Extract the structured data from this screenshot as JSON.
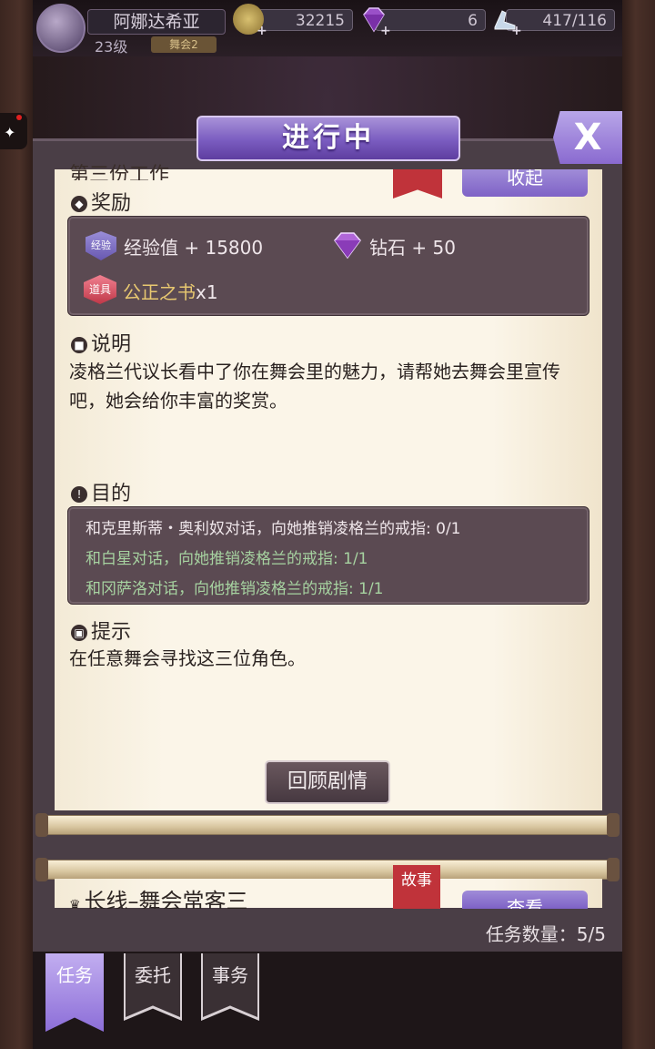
{
  "player": {
    "name": "阿娜达希亚",
    "level": "23级",
    "tag": "舞会2"
  },
  "resources": {
    "coins": "32215",
    "diamonds": "6",
    "stamina": "417/116"
  },
  "header": {
    "title": "进行中",
    "close_label": "X"
  },
  "current_quest": {
    "title": "第三份工作",
    "collapse_label": "收起",
    "reward_heading": "奖励",
    "rewards": {
      "exp_badge": "经验",
      "exp": "经验值 + 15800",
      "diamond": "钻石 + 50",
      "item_badge": "道具",
      "item_name": "公正之书",
      "item_qty": "x1"
    },
    "desc_heading": "说明",
    "description": "凌格兰代议长看中了你在舞会里的魅力，请帮她去舞会里宣传吧，她会给你丰富的奖赏。",
    "goal_heading": "目的",
    "goals": [
      {
        "text": "和克里斯蒂・奥利奴对话，向她推销凌格兰的戒指: 0/1",
        "done": false
      },
      {
        "text": "和白星对话，向她推销凌格兰的戒指: 1/1",
        "done": true
      },
      {
        "text": "和冈萨洛对话，向他推销凌格兰的戒指: 1/1",
        "done": true
      }
    ],
    "hint_heading": "提示",
    "hint": "在任意舞会寻找这三位角色。",
    "review_label": "回顾剧情"
  },
  "next_quest": {
    "title": "长线–舞会常客三",
    "tag": "故事",
    "view_label": "查看"
  },
  "task_count": "任务数量：5/5",
  "tabs": {
    "tasks": "任务",
    "commission": "委托",
    "affairs": "事务"
  },
  "colors": {
    "accent_purple": "#8c6ed8",
    "bookmark_red": "#c0333a",
    "done_green": "#a6d2a0"
  }
}
